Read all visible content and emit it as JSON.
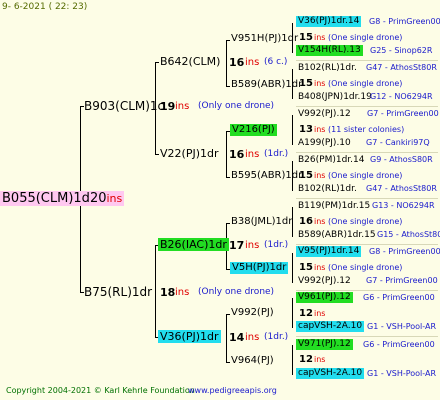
{
  "date": "9- 6-2021 ( 22: 23)",
  "copyright": "Copyright 2004-2021 © Karl Kehrle Foundation",
  "site": "www.pedigreeapis.org",
  "root": {
    "name": "B055(CLM)1d",
    "num": "20",
    "unit": "ins"
  },
  "gen1": [
    {
      "name": "B903(CLM)1c",
      "num": "19",
      "unit": "ins",
      "note": "(Only one drone)"
    },
    {
      "name": "B75(RL)1dr",
      "num": "18",
      "unit": "ins",
      "note": "(Only one drone)"
    }
  ],
  "gen2": [
    {
      "name": "B642(CLM)",
      "num": "16",
      "unit": "ins",
      "note": "(6 c.)"
    },
    {
      "name": "V22(PJ)1dr",
      "num": "16",
      "unit": "ins",
      "note": "(1dr.)"
    },
    {
      "name": "B26(IAC)1dr",
      "num": "17",
      "unit": "ins",
      "note": "(1dr.)"
    },
    {
      "name": "V36(PJ)1dr",
      "num": "14",
      "unit": "ins",
      "note": "(1dr.)"
    }
  ],
  "gen3": [
    {
      "name": "V951H(PJ)1dr",
      "num": "15",
      "unit": "ins",
      "note": "(One single drone)"
    },
    {
      "name": "B589(ABR)1dr",
      "num": "15",
      "unit": "ins",
      "note": "(One single drone)"
    },
    {
      "name": "V216(PJ)",
      "num": "13",
      "unit": "ins",
      "note": "(11 sister colonies)"
    },
    {
      "name": "B595(ABR)1dr",
      "num": "15",
      "unit": "ins",
      "note": "(One single drone)"
    },
    {
      "name": "B38(JML)1dr",
      "num": "16",
      "unit": "ins",
      "note": "(One single drone)"
    },
    {
      "name": "V5H(PJ)1dr",
      "num": "15",
      "unit": "ins",
      "note": "(One single drone)"
    },
    {
      "name": "V992(PJ)",
      "num": "12",
      "unit": "ins",
      "note": ""
    },
    {
      "name": "V964(PJ)",
      "num": "12",
      "unit": "ins",
      "note": ""
    }
  ],
  "gen4": [
    {
      "name": "V36(PJ)1dr.14",
      "src": "G8 - PrimGreen00"
    },
    {
      "name": "V154H(RL).13",
      "src": "G25 - Sinop62R"
    },
    {
      "name": "B102(RL)1dr.",
      "src": "G47 - AthosSt80R"
    },
    {
      "name": "B408(JPN)1dr.19",
      "src": "G12 - NO6294R"
    },
    {
      "name": "V992(PJ).12",
      "src": "G7 - PrimGreen00"
    },
    {
      "name": "A199(PJ).10",
      "src": "G7 - Cankiri97Q"
    },
    {
      "name": "B26(PM)1dr.14",
      "src": "G9 - AthosS80R"
    },
    {
      "name": "B102(RL)1dr.",
      "src": "G47 - AthosSt80R"
    },
    {
      "name": "B119(PM)1dr.15",
      "src": "G13 - NO6294R"
    },
    {
      "name": "B589(ABR)1dr.15",
      "src": "G15 - AthosSt80R"
    },
    {
      "name": "V95(PJ)1dr.14",
      "src": "G8 - PrimGreen00"
    },
    {
      "name": "V992(PJ).12",
      "src": "G7 - PrimGreen00"
    },
    {
      "name": "V961(PJ).12",
      "src": "G6 - PrimGreen00"
    },
    {
      "name": "capVSH-2A.10",
      "src": "G1 - VSH-Pool-AR"
    },
    {
      "name": "V971(PJ).12",
      "src": "G6 - PrimGreen00"
    },
    {
      "name": "capVSH-2A.10",
      "src": "G1 - VSH-Pool-AR"
    }
  ],
  "colors": {
    "green": "#22dd22",
    "cyan": "#22ddee",
    "pink": "#ffc8f0",
    "red": "#e00000",
    "blue": "#1a1acc"
  }
}
